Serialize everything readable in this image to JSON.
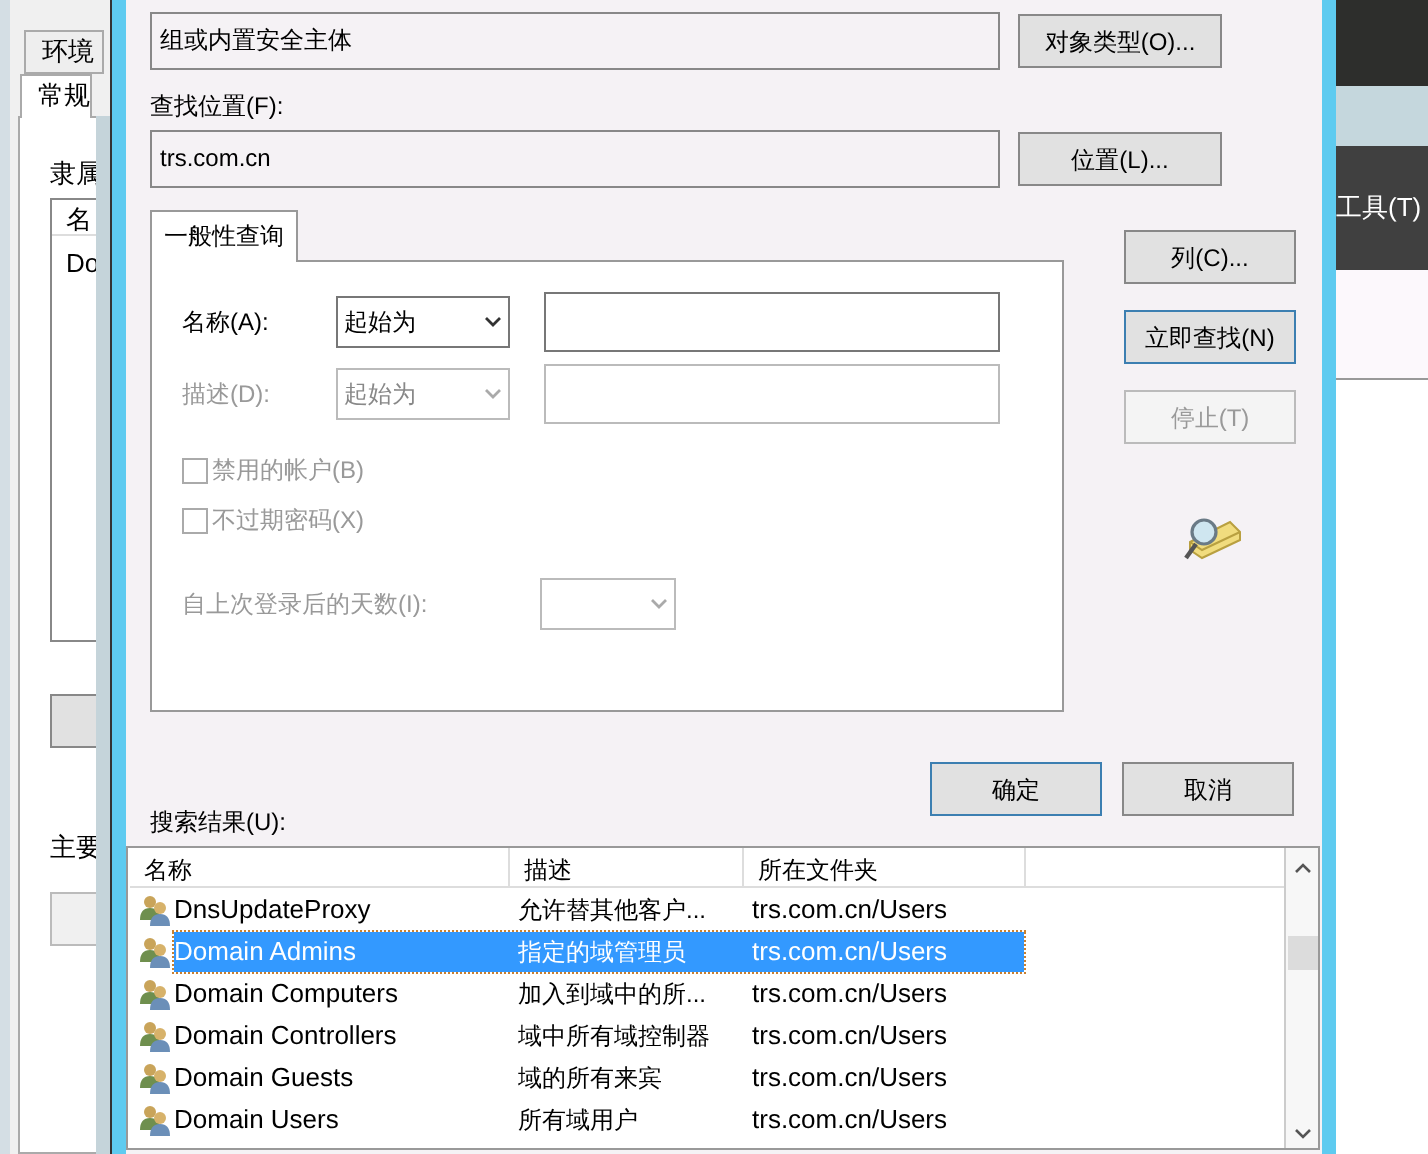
{
  "background_window": {
    "tabs": [
      {
        "label": "环境",
        "selected": false
      },
      {
        "label": "常规",
        "selected": true
      }
    ],
    "section_label": "隶属",
    "list_header": "名",
    "list_rows": [
      "Do"
    ],
    "footer_label": "主要"
  },
  "right_window": {
    "menu_item": "工具(T)"
  },
  "dialog": {
    "object_type_field": {
      "value": "组或内置安全主体"
    },
    "object_type_button": "对象类型(O)...",
    "location_label": "查找位置(F):",
    "location_field": {
      "value": "trs.com.cn"
    },
    "location_button": "位置(L)...",
    "query_tabs": [
      {
        "label": "一般性查询",
        "selected": true
      }
    ],
    "criteria": [
      {
        "label": "名称(A):",
        "match": "起始为",
        "disabled": false
      },
      {
        "label": "描述(D):",
        "match": "起始为",
        "disabled": true
      }
    ],
    "checkboxes": [
      {
        "label": "禁用的帐户(B)",
        "checked": false,
        "disabled": true
      },
      {
        "label": "不过期密码(X)",
        "checked": false,
        "disabled": true
      }
    ],
    "days_row": {
      "label": "自上次登录后的天数(I):",
      "disabled": true
    },
    "side_buttons": [
      {
        "label": "列(C)...",
        "focused": false,
        "disabled": false
      },
      {
        "label": "立即查找(N)",
        "focused": true,
        "disabled": false
      },
      {
        "label": "停止(T)",
        "focused": false,
        "disabled": true
      }
    ],
    "dialog_buttons": [
      {
        "label": "确定",
        "focused": true
      },
      {
        "label": "取消",
        "focused": false
      }
    ],
    "results_label": "搜索结果(U):",
    "results": {
      "columns": [
        "名称",
        "描述",
        "所在文件夹"
      ],
      "rows": [
        {
          "name": "DnsUpdateProxy",
          "description": "允许替其他客户...",
          "folder": "trs.com.cn/Users",
          "selected": false
        },
        {
          "name": "Domain Admins",
          "description": "指定的域管理员",
          "folder": "trs.com.cn/Users",
          "selected": true
        },
        {
          "name": "Domain Computers",
          "description": "加入到域中的所...",
          "folder": "trs.com.cn/Users",
          "selected": false
        },
        {
          "name": "Domain Controllers",
          "description": "域中所有域控制器",
          "folder": "trs.com.cn/Users",
          "selected": false
        },
        {
          "name": "Domain Guests",
          "description": "域的所有来宾",
          "folder": "trs.com.cn/Users",
          "selected": false
        },
        {
          "name": "Domain Users",
          "description": "所有域用户",
          "folder": "trs.com.cn/Users",
          "selected": false
        }
      ]
    }
  }
}
